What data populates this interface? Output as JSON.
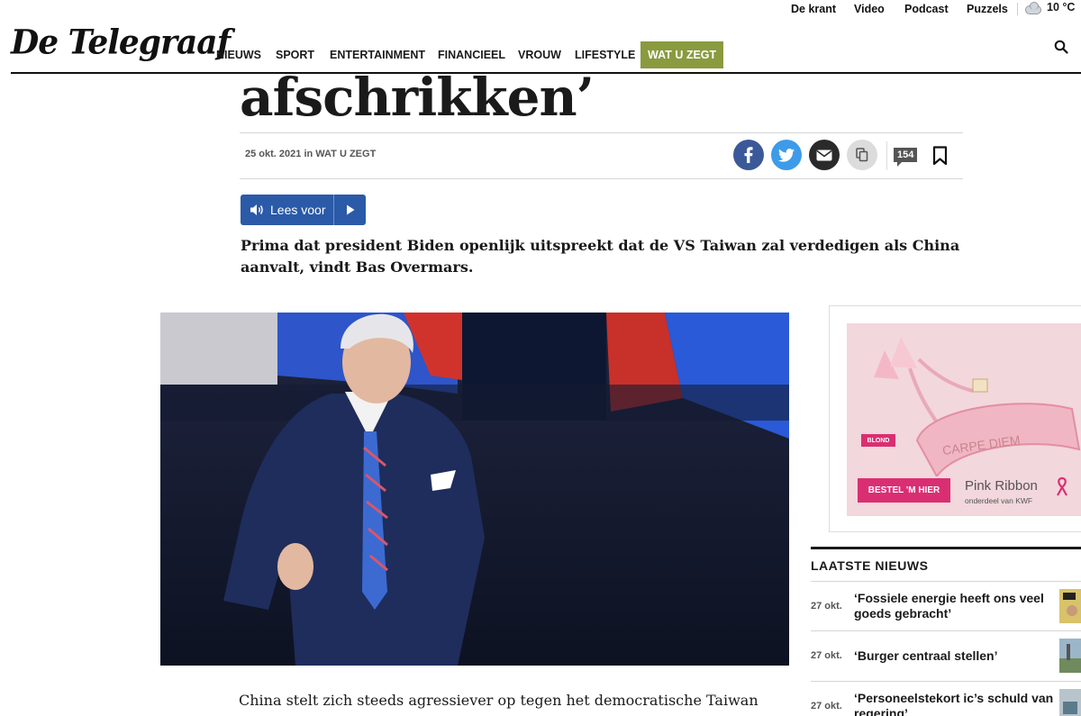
{
  "utility": {
    "links": [
      "De krant",
      "Video",
      "Podcast",
      "Puzzels"
    ],
    "weather": "10 °C"
  },
  "header": {
    "logo": "De Telegraaf",
    "nav": [
      "NIEUWS",
      "SPORT",
      "ENTERTAINMENT",
      "FINANCIEEL",
      "VROUW",
      "LIFESTYLE",
      "WAT U ZEGT"
    ],
    "active_nav": "WAT U ZEGT",
    "accent_color": "#8a9a3f"
  },
  "article": {
    "headline_fragment": "afschrikken’",
    "date": "25 okt. 2021",
    "in_label": "in",
    "section": "WAT U ZEGT",
    "comment_count": "154",
    "read_aloud_label": "Lees voor",
    "intro": "Prima dat president Biden openlijk uitspreekt dat de VS Taiwan zal verdedigen als China aanvalt, vindt Bas Overmars.",
    "body_first_line": "China stelt zich steeds agressiever op tegen het democratische Taiwan"
  },
  "ad": {
    "button_label": "BESTEL 'M HIER",
    "brand": "Pink Ribbon",
    "sub": "onderdeel van KWF",
    "blond_label": "BLOND",
    "bracelet_text": "CARPE DIEM"
  },
  "latest_news": {
    "title": "LAATSTE NIEUWS",
    "items": [
      {
        "date": "27 okt.",
        "headline": "‘Fossiele energie heeft ons veel goeds gebracht’"
      },
      {
        "date": "27 okt.",
        "headline": "‘Burger centraal stellen’"
      },
      {
        "date": "27 okt.",
        "headline": "‘Personeelstekort ic’s schuld van regering’"
      }
    ]
  }
}
